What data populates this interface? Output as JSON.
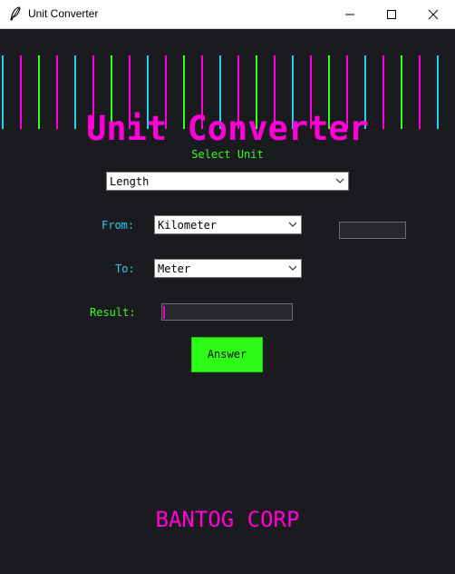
{
  "window": {
    "title": "Unit Converter",
    "icon": "feather-icon"
  },
  "colors": {
    "background": "#1a1b1f",
    "accent_magenta": "#ff00d6",
    "accent_green": "#35ff1f",
    "accent_cyan": "#1fd1f4",
    "button_green": "#2efc16"
  },
  "header": {
    "title": "Unit Converter",
    "subtitle": "Select Unit"
  },
  "category_select": {
    "value": "Length"
  },
  "from": {
    "label": "From:",
    "unit": "Kilometer",
    "input_value": ""
  },
  "to": {
    "label": "To:",
    "unit": "Meter"
  },
  "result": {
    "label": "Result:",
    "value": ""
  },
  "answer_button": {
    "label": "Answer"
  },
  "footer": {
    "text": "BANTOG CORP"
  }
}
